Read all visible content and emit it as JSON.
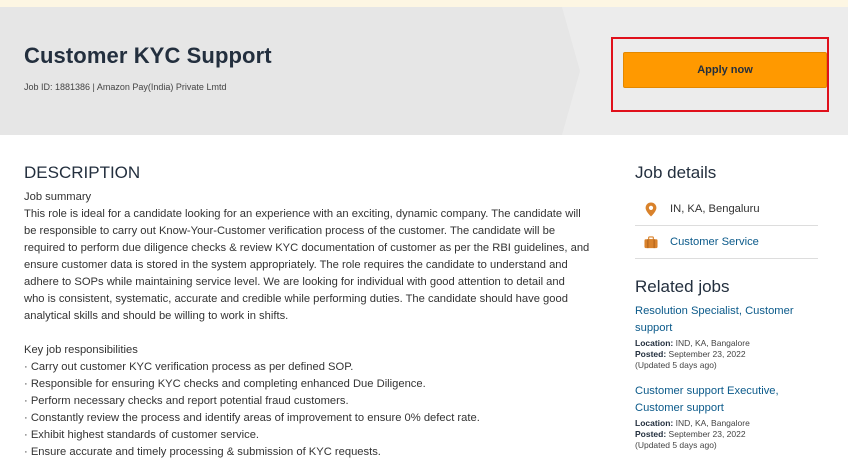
{
  "header": {
    "title": "Customer KYC Support",
    "meta": "Job ID: 1881386 | Amazon Pay(India) Private Lmtd",
    "apply_label": "Apply now"
  },
  "description": {
    "heading": "DESCRIPTION",
    "summary_label": "Job summary",
    "summary_lines": [
      "This role is ideal for a candidate looking for an experience with an exciting, dynamic company. The candidate will",
      "be responsible to carry out Know-Your-Customer verification process of the customer. The candidate will be",
      "required to perform due diligence checks & review KYC documentation of customer as per the RBI guidelines, and",
      "ensure customer data is stored in the system appropriately. The role requires the candidate to understand and",
      "adhere to SOPs while maintaining service level. We are looking for individual with good attention to detail and",
      "who is consistent, systematic, accurate and credible while performing duties. The candidate should have good",
      "analytical skills and should be willing to work in shifts."
    ],
    "responsibilities_label": "Key job responsibilities",
    "responsibilities": [
      "· Carry out customer KYC verification process as per defined SOP.",
      "· Responsible for ensuring KYC checks and completing enhanced Due Diligence.",
      "· Perform necessary checks and report potential fraud customers.",
      "· Constantly review the process and identify areas of improvement to ensure 0% defect rate.",
      "· Exhibit highest standards of customer service.",
      "· Ensure accurate and timely processing & submission of KYC requests."
    ]
  },
  "sidebar": {
    "job_details_heading": "Job details",
    "location": "IN, KA, Bengaluru",
    "category": "Customer Service",
    "related_heading": "Related jobs",
    "related_jobs": [
      {
        "title": "Resolution Specialist, Customer support",
        "location_label": "Location:",
        "location": "IND, KA, Bangalore",
        "posted_label": "Posted:",
        "posted": "September 23, 2022",
        "updated": "(Updated 5 days ago)"
      },
      {
        "title": "Customer support Executive, Customer support",
        "location_label": "Location:",
        "location": "IND, KA, Bangalore",
        "posted_label": "Posted:",
        "posted": "September 23, 2022",
        "updated": "(Updated 5 days ago)"
      }
    ]
  },
  "colors": {
    "apply_button": "#ff9900",
    "highlight_box": "#e0101b",
    "link": "#0b5a8a",
    "icon_orange": "#d9822b"
  },
  "icons": {
    "location": "map-pin-icon",
    "category": "briefcase-icon"
  }
}
